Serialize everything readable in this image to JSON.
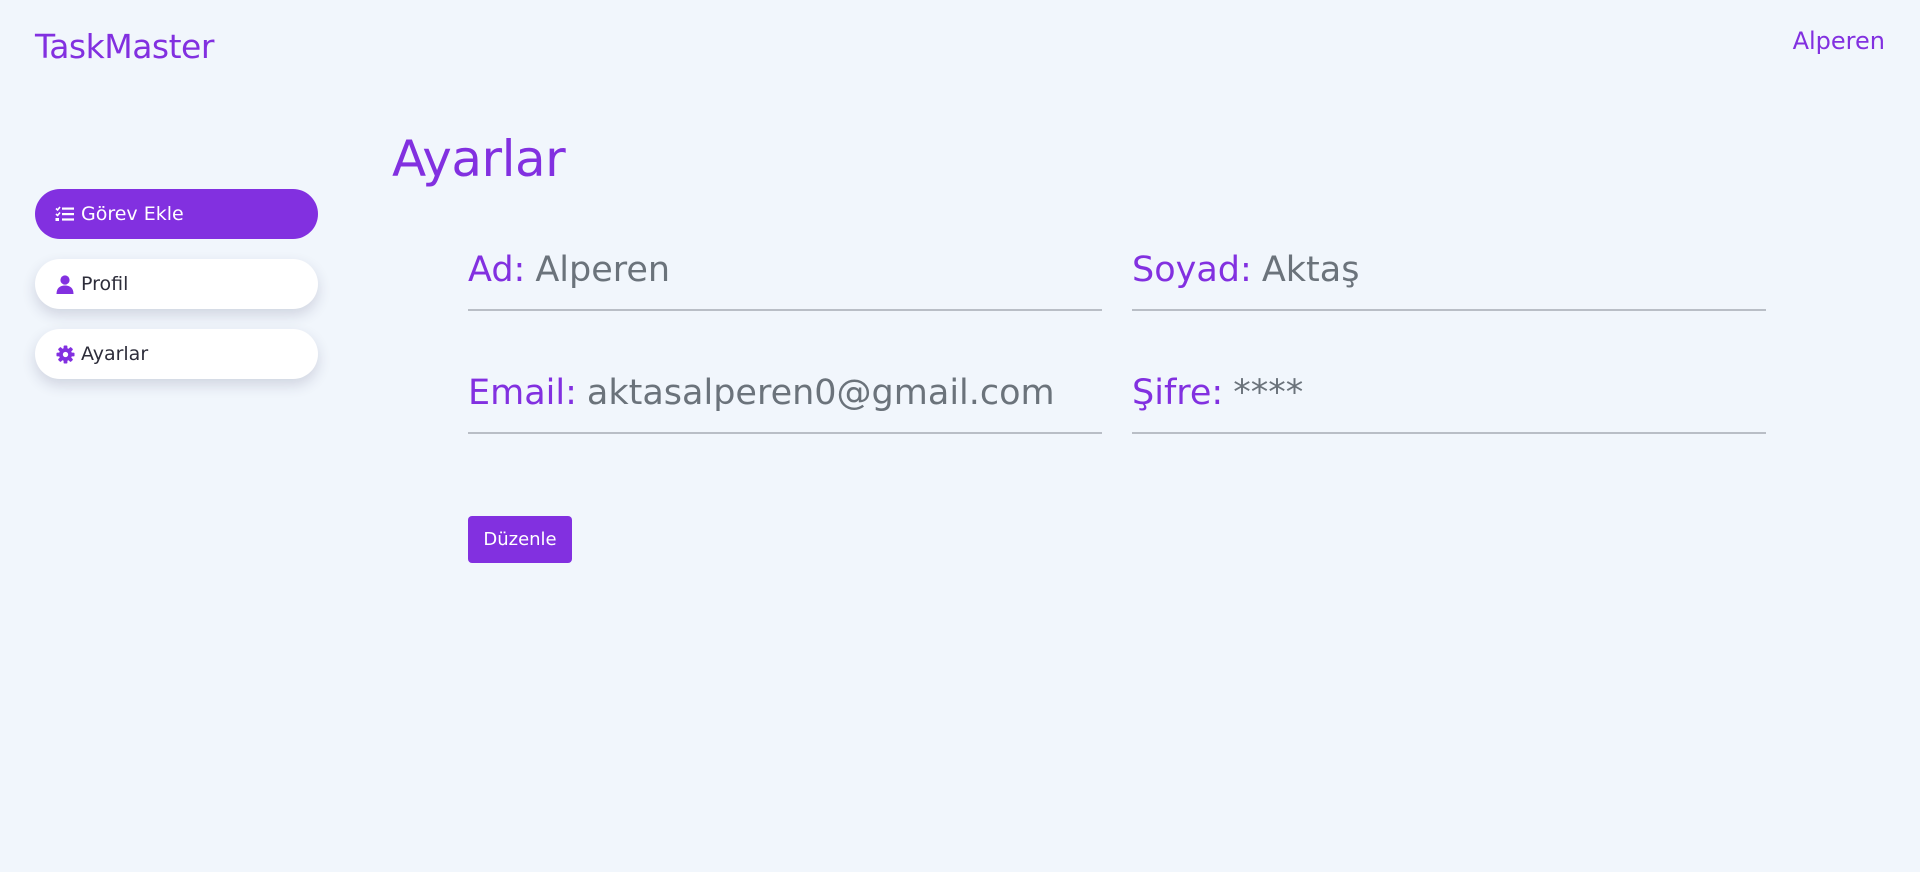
{
  "header": {
    "brand": "TaskMaster",
    "user_name": "Alperen"
  },
  "sidebar": {
    "items": [
      {
        "label": "Görev Ekle",
        "icon": "task-list-icon",
        "active": true
      },
      {
        "label": "Profil",
        "icon": "user-icon",
        "active": false
      },
      {
        "label": "Ayarlar",
        "icon": "gear-icon",
        "active": false
      }
    ]
  },
  "main": {
    "title": "Ayarlar",
    "fields": {
      "ad": {
        "label": "Ad:",
        "value": "Alperen"
      },
      "soyad": {
        "label": "Soyad:",
        "value": "Aktaş"
      },
      "email": {
        "label": "Email:",
        "value": "aktasalperen0@gmail.com"
      },
      "sifre": {
        "label": "Şifre:",
        "value": "****"
      }
    },
    "edit_button": "Düzenle"
  },
  "colors": {
    "accent": "#8230e0",
    "background": "#f1f6fc",
    "value_text": "#6b737b"
  }
}
